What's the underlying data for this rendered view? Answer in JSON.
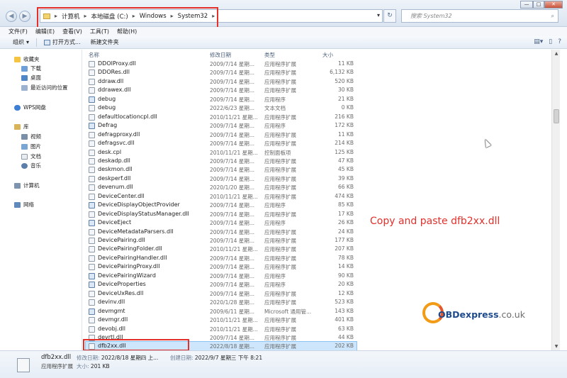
{
  "window": {
    "nav_back": "◀",
    "nav_forward": "▶",
    "breadcrumbs": [
      "计算机",
      "本地磁盘 (C:)",
      "Windows",
      "System32"
    ],
    "crumb_separator": "▸",
    "search_placeholder": "搜索 System32",
    "controls": {
      "minimize": "—",
      "maximize": "□",
      "close": "✕"
    }
  },
  "menubar": [
    "文件(F)",
    "编辑(E)",
    "查看(V)",
    "工具(T)",
    "帮助(H)"
  ],
  "toolbar": {
    "organize": "组织",
    "open_with": "打开方式...",
    "new_folder": "新建文件夹"
  },
  "navpane": {
    "favorites": "收藏夹",
    "favorites_items": [
      "下载",
      "桌面",
      "最近访问的位置"
    ],
    "wps": "WPS网盘",
    "libraries": "库",
    "library_items": [
      "视频",
      "图片",
      "文档",
      "音乐"
    ],
    "computer": "计算机",
    "network": "网络"
  },
  "columns": {
    "name": "名称",
    "date": "修改日期",
    "type": "类型",
    "size": "大小"
  },
  "files": [
    {
      "name": "DDOIProxy.dll",
      "date": "2009/7/14 星期...",
      "type": "应用程序扩展",
      "size": "11 KB",
      "icon": "dll"
    },
    {
      "name": "DDORes.dll",
      "date": "2009/7/14 星期...",
      "type": "应用程序扩展",
      "size": "6,132 KB",
      "icon": "dll"
    },
    {
      "name": "ddraw.dll",
      "date": "2009/7/14 星期...",
      "type": "应用程序扩展",
      "size": "520 KB",
      "icon": "dll"
    },
    {
      "name": "ddrawex.dll",
      "date": "2009/7/14 星期...",
      "type": "应用程序扩展",
      "size": "30 KB",
      "icon": "dll"
    },
    {
      "name": "debug",
      "date": "2009/7/14 星期...",
      "type": "应用程序",
      "size": "21 KB",
      "icon": "app"
    },
    {
      "name": "debug",
      "date": "2022/6/23 星期...",
      "type": "文本文档",
      "size": "0 KB",
      "icon": "txt"
    },
    {
      "name": "defaultlocationcpl.dll",
      "date": "2010/11/21 星期...",
      "type": "应用程序扩展",
      "size": "216 KB",
      "icon": "dll"
    },
    {
      "name": "Defrag",
      "date": "2009/7/14 星期...",
      "type": "应用程序",
      "size": "172 KB",
      "icon": "app"
    },
    {
      "name": "defragproxy.dll",
      "date": "2009/7/14 星期...",
      "type": "应用程序扩展",
      "size": "11 KB",
      "icon": "dll"
    },
    {
      "name": "defragsvc.dll",
      "date": "2009/7/14 星期...",
      "type": "应用程序扩展",
      "size": "214 KB",
      "icon": "dll"
    },
    {
      "name": "desk.cpl",
      "date": "2010/11/21 星期...",
      "type": "控制面板项",
      "size": "125 KB",
      "icon": "dll"
    },
    {
      "name": "deskadp.dll",
      "date": "2009/7/14 星期...",
      "type": "应用程序扩展",
      "size": "47 KB",
      "icon": "dll"
    },
    {
      "name": "deskmon.dll",
      "date": "2009/7/14 星期...",
      "type": "应用程序扩展",
      "size": "45 KB",
      "icon": "dll"
    },
    {
      "name": "deskperf.dll",
      "date": "2009/7/14 星期...",
      "type": "应用程序扩展",
      "size": "39 KB",
      "icon": "dll"
    },
    {
      "name": "devenum.dll",
      "date": "2020/1/20 星期...",
      "type": "应用程序扩展",
      "size": "66 KB",
      "icon": "dll"
    },
    {
      "name": "DeviceCenter.dll",
      "date": "2010/11/21 星期...",
      "type": "应用程序扩展",
      "size": "474 KB",
      "icon": "dll"
    },
    {
      "name": "DeviceDisplayObjectProvider",
      "date": "2009/7/14 星期...",
      "type": "应用程序",
      "size": "85 KB",
      "icon": "app"
    },
    {
      "name": "DeviceDisplayStatusManager.dll",
      "date": "2009/7/14 星期...",
      "type": "应用程序扩展",
      "size": "17 KB",
      "icon": "dll"
    },
    {
      "name": "DeviceEject",
      "date": "2009/7/14 星期...",
      "type": "应用程序",
      "size": "26 KB",
      "icon": "app"
    },
    {
      "name": "DeviceMetadataParsers.dll",
      "date": "2009/7/14 星期...",
      "type": "应用程序扩展",
      "size": "24 KB",
      "icon": "dll"
    },
    {
      "name": "DevicePairing.dll",
      "date": "2009/7/14 星期...",
      "type": "应用程序扩展",
      "size": "177 KB",
      "icon": "dll"
    },
    {
      "name": "DevicePairingFolder.dll",
      "date": "2010/11/21 星期...",
      "type": "应用程序扩展",
      "size": "207 KB",
      "icon": "dll"
    },
    {
      "name": "DevicePairingHandler.dll",
      "date": "2009/7/14 星期...",
      "type": "应用程序扩展",
      "size": "78 KB",
      "icon": "dll"
    },
    {
      "name": "DevicePairingProxy.dll",
      "date": "2009/7/14 星期...",
      "type": "应用程序扩展",
      "size": "14 KB",
      "icon": "dll"
    },
    {
      "name": "DevicePairingWizard",
      "date": "2009/7/14 星期...",
      "type": "应用程序",
      "size": "90 KB",
      "icon": "app"
    },
    {
      "name": "DeviceProperties",
      "date": "2009/7/14 星期...",
      "type": "应用程序",
      "size": "20 KB",
      "icon": "app"
    },
    {
      "name": "DeviceUxRes.dll",
      "date": "2009/7/14 星期...",
      "type": "应用程序扩展",
      "size": "12 KB",
      "icon": "dll"
    },
    {
      "name": "devinv.dll",
      "date": "2020/1/28 星期...",
      "type": "应用程序扩展",
      "size": "523 KB",
      "icon": "dll"
    },
    {
      "name": "devmgmt",
      "date": "2009/6/11 星期...",
      "type": "Microsoft 通用管...",
      "size": "143 KB",
      "icon": "app"
    },
    {
      "name": "devmgr.dll",
      "date": "2010/11/21 星期...",
      "type": "应用程序扩展",
      "size": "401 KB",
      "icon": "dll"
    },
    {
      "name": "devobj.dll",
      "date": "2010/11/21 星期...",
      "type": "应用程序扩展",
      "size": "63 KB",
      "icon": "dll"
    },
    {
      "name": "devrtl.dll",
      "date": "2009/7/14 星期...",
      "type": "应用程序扩展",
      "size": "44 KB",
      "icon": "dll"
    },
    {
      "name": "dfb2xx.dll",
      "date": "2022/8/18 星期...",
      "type": "应用程序扩展",
      "size": "202 KB",
      "icon": "dll",
      "selected": true
    }
  ],
  "annotation": "Copy and paste dfb2xx.dll",
  "watermark": {
    "brand": "OBDexpress",
    "domain": ".co.uk"
  },
  "details": {
    "name": "dfb2xx.dll",
    "type": "应用程序扩展",
    "modified_label": "修改日期:",
    "modified_value": "2022/8/18 星期四 上...",
    "created_label": "创建日期:",
    "created_value": "2022/9/7 星期三 下午 8:21",
    "size_label": "大小:",
    "size_value": "201 KB"
  },
  "colors": {
    "highlight": "#e3302b",
    "selection": "#cde6fb",
    "watermark_blue": "#1e4b8e",
    "watermark_orange": "#f29b17"
  }
}
